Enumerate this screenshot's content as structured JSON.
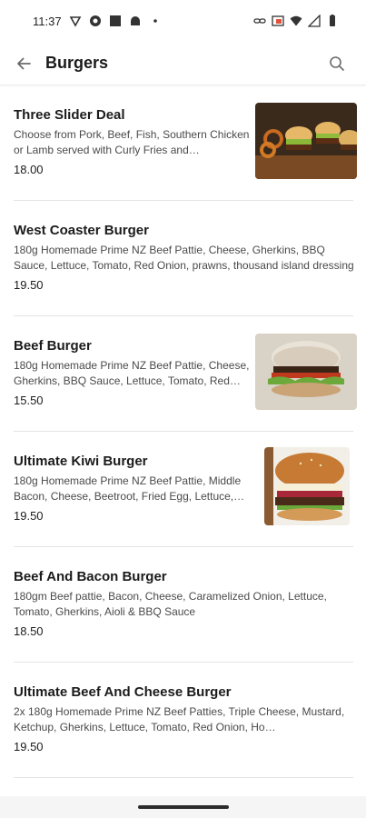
{
  "status_bar": {
    "time": "11:37",
    "left_icons": [
      "vpn-icon",
      "sync-icon",
      "app-square-icon",
      "android-icon",
      "dot-icon"
    ],
    "right_icons": [
      "link-icon",
      "cast-icon",
      "wifi-icon",
      "signal-icon",
      "battery-icon"
    ]
  },
  "header": {
    "title": "Burgers",
    "back_icon": "back-arrow-icon",
    "search_icon": "search-icon"
  },
  "menu_items": [
    {
      "name": "Three Slider Deal",
      "description": "Choose from Pork, Beef, Fish, Southern Chicken or Lamb served with Curly Fries and…",
      "price": "18.00",
      "image": "slider-burgers-photo"
    },
    {
      "name": "West Coaster Burger",
      "description": "180g Homemade Prime NZ Beef Pattie, Cheese, Gherkins, BBQ Sauce, Lettuce, Tomato, Red Onion, prawns, thousand island dressing",
      "price": "19.50",
      "image": null
    },
    {
      "name": "Beef Burger",
      "description": "180g Homemade Prime NZ Beef Pattie, Cheese, Gherkins, BBQ Sauce, Lettuce, Tomato, Red Onion",
      "price": "15.50",
      "image": "beef-burger-photo"
    },
    {
      "name": "Ultimate Kiwi Burger",
      "description": "180g Homemade Prime NZ Beef Pattie, Middle Bacon, Cheese, Beetroot, Fried Egg, Lettuce, Tomato",
      "price": "19.50",
      "image": "kiwi-burger-photo"
    },
    {
      "name": "Beef And Bacon Burger",
      "description": "180gm Beef pattie, Bacon, Cheese, Caramelized Onion, Lettuce, Tomato, Gherkins, Aioli & BBQ Sauce",
      "price": "18.50",
      "image": null
    },
    {
      "name": "Ultimate Beef And Cheese Burger",
      "description": "2x 180g Homemade Prime NZ Beef Patties, Triple Cheese, Mustard, Ketchup, Gherkins, Lettuce, Tomato, Red Onion, Ho…",
      "price": "19.50",
      "image": null
    }
  ],
  "colors": {
    "background": "#ffffff",
    "text_primary": "#1b1b1b",
    "text_secondary": "#4a4a4a",
    "divider": "#e3e3e3"
  }
}
